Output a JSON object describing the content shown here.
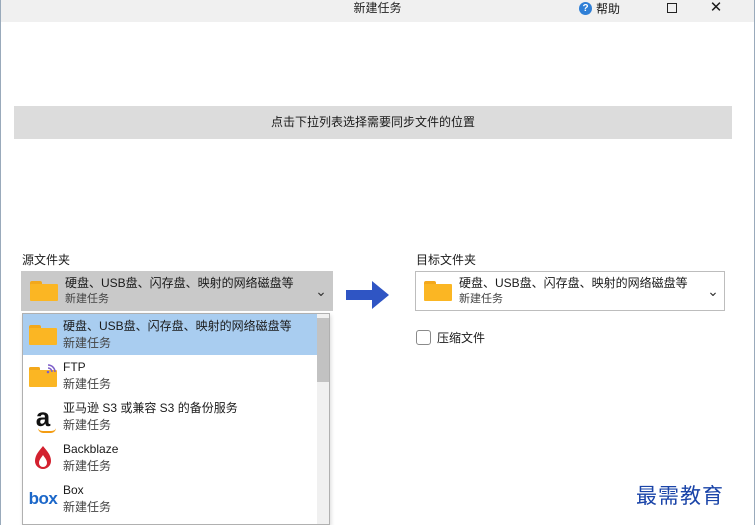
{
  "window": {
    "title": "新建任务",
    "help_label": "帮助",
    "help_icon": "?",
    "close_glyph": "✕"
  },
  "banner": {
    "text": "点击下拉列表选择需要同步文件的位置"
  },
  "source": {
    "label": "源文件夹",
    "selected_main": "硬盘、USB盘、闪存盘、映射的网络磁盘等",
    "selected_sub": "新建任务",
    "chevron": "⌄"
  },
  "destination": {
    "label": "目标文件夹",
    "selected_main": "硬盘、USB盘、闪存盘、映射的网络磁盘等",
    "selected_sub": "新建任务",
    "chevron": "⌄"
  },
  "compress": {
    "label": "压缩文件",
    "checked": false
  },
  "dropdown": {
    "items": [
      {
        "icon": "folder-icon",
        "title": "硬盘、USB盘、闪存盘、映射的网络磁盘等",
        "sub": "新建任务",
        "selected": true
      },
      {
        "icon": "ftp-folder-icon",
        "title": "FTP",
        "sub": "新建任务",
        "selected": false
      },
      {
        "icon": "amazon-icon",
        "title": "亚马逊 S3 或兼容 S3 的备份服务",
        "sub": "新建任务",
        "selected": false,
        "logo_text": "a"
      },
      {
        "icon": "backblaze-icon",
        "title": "Backblaze",
        "sub": "新建任务",
        "selected": false
      },
      {
        "icon": "box-icon",
        "title": "Box",
        "sub": "新建任务",
        "selected": false,
        "logo_text": "box"
      }
    ]
  },
  "watermark": {
    "text": "最需教育"
  },
  "colors": {
    "accent_blue": "#2f55c4",
    "folder_yellow": "#fbb623",
    "selected_row": "#a9cdf0"
  }
}
